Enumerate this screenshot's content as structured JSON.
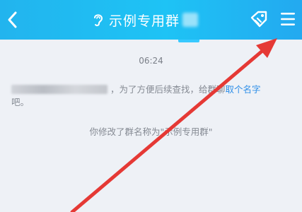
{
  "header": {
    "title": "示例专用群",
    "bg_color": "#1ec3f5"
  },
  "icons": {
    "back": "chevron-left-icon",
    "ear": "ear-icon",
    "tag": "tag-icon",
    "menu": "menu-icon"
  },
  "chat": {
    "timestamp": "06:24",
    "system_message": {
      "text": "，为了方便后续查找，给群聊",
      "link": "取个名字",
      "tail": "吧。"
    },
    "rename_notice": "你修改了群名称为\"示例专用群\""
  },
  "annotation": {
    "arrow_color": "#e53935"
  }
}
